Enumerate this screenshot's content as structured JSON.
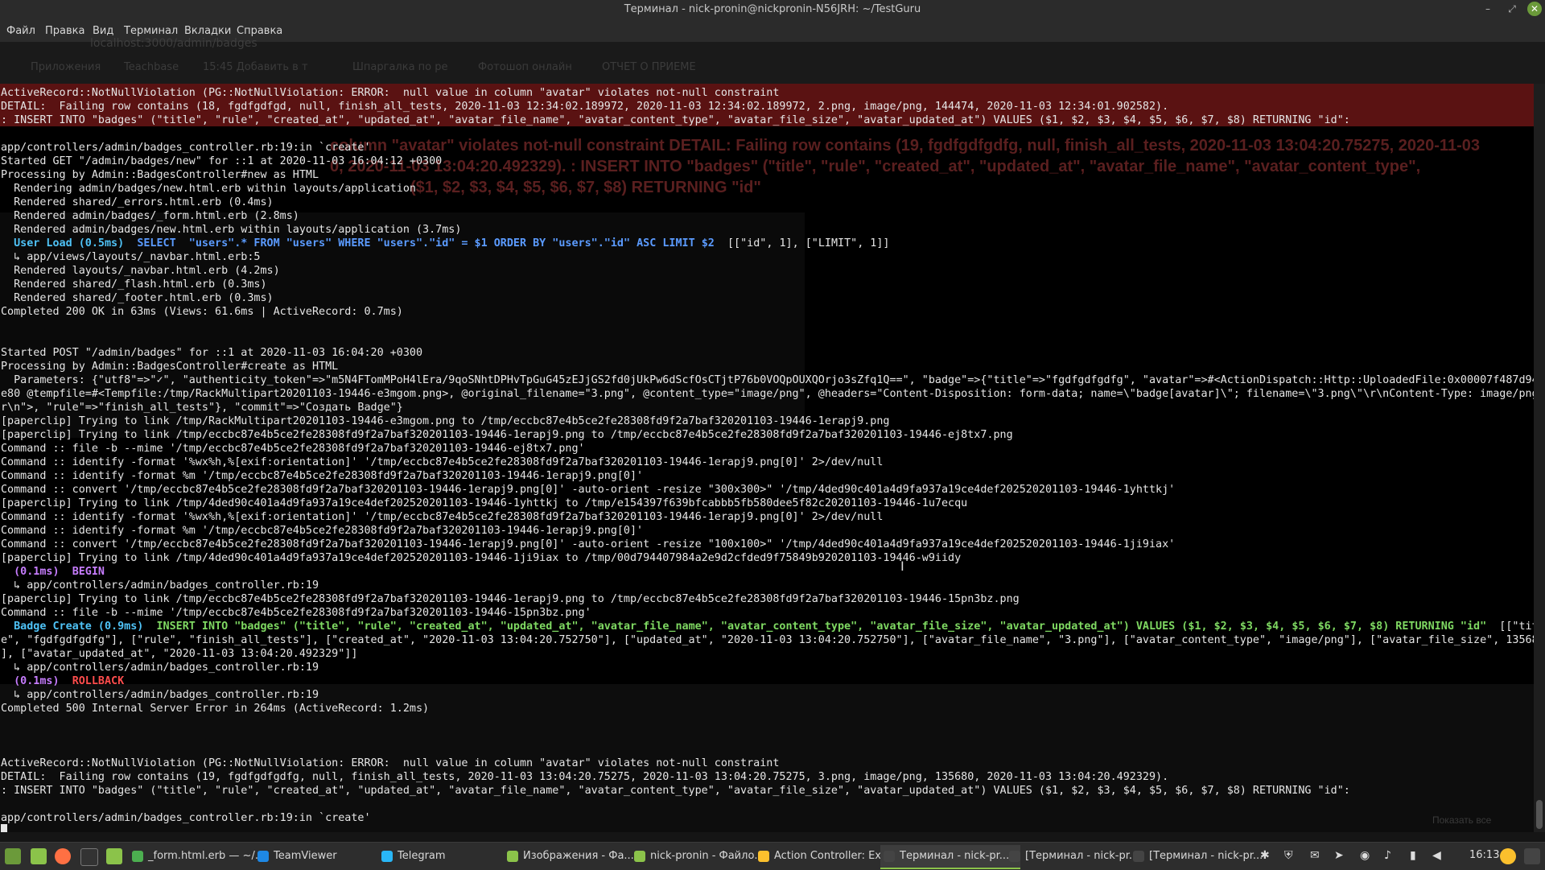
{
  "window": {
    "title": "Терминал - nick-pronin@nickpronin-N56JRH: ~/TestGuru",
    "controls": [
      "–",
      "⤢",
      "✕"
    ]
  },
  "menu": [
    "Файл",
    "Правка",
    "Вид",
    "Терминал",
    "Вкладки",
    "Справка"
  ],
  "ghost_browser": {
    "url": "localhost:3000/admin/badges",
    "bookmarks": [
      "Приложения",
      "Teachbase",
      "15:45 Добавить в т",
      "Шпаргалка по ре",
      "Фотошоп онлайн",
      "ОТЧЕТ О ПРИЕМЕ"
    ]
  },
  "ghost_error": [
    "column \"avatar\" violates not-null constraint DETAIL: Failing row contains (19, fgdfgdfgdfg, null, finish_all_tests, 2020-11-03 13:04:20.75275, 2020-11-03",
    "0, 2020-11-03 13:04:20.492329). : INSERT INTO \"badges\" (\"title\", \"rule\", \"created_at\", \"updated_at\", \"avatar_file_name\", \"avatar_content_type\",",
    "($1, $2, $3, $4, $5, $6, $7, $8) RETURNING \"id\""
  ],
  "terminal": {
    "lines": [
      {
        "row": 0,
        "text": "ActiveRecord::NotNullViolation (PG::NotNullViolation: ERROR:  null value in column \"avatar\" violates not-null constraint"
      },
      {
        "row": 1,
        "text": "DETAIL:  Failing row contains (18, fgdfgdfgd, null, finish_all_tests, 2020-11-03 12:34:02.189972, 2020-11-03 12:34:02.189972, 2.png, image/png, 144474, 2020-11-03 12:34:01.902582)."
      },
      {
        "row": 2,
        "text": ": INSERT INTO \"badges\" (\"title\", \"rule\", \"created_at\", \"updated_at\", \"avatar_file_name\", \"avatar_content_type\", \"avatar_file_size\", \"avatar_updated_at\") VALUES ($1, $2, $3, $4, $5, $6, $7, $8) RETURNING \"id\":"
      },
      {
        "row": 4,
        "text": "app/controllers/admin/badges_controller.rb:19:in `create'"
      },
      {
        "row": 5,
        "text": "Started GET \"/admin/badges/new\" for ::1 at 2020-11-03 16:04:12 +0300"
      },
      {
        "row": 6,
        "text": "Processing by Admin::BadgesController#new as HTML"
      },
      {
        "row": 7,
        "text": "  Rendering admin/badges/new.html.erb within layouts/application"
      },
      {
        "row": 8,
        "text": "  Rendered shared/_errors.html.erb (0.4ms)"
      },
      {
        "row": 9,
        "text": "  Rendered admin/badges/_form.html.erb (2.8ms)"
      },
      {
        "row": 10,
        "text": "  Rendered admin/badges/new.html.erb within layouts/application (3.7ms)"
      },
      {
        "row": 11,
        "segments": [
          {
            "text": "  "
          },
          {
            "text": "User Load (0.5ms)",
            "cls": "c-cyan"
          },
          {
            "text": "  "
          },
          {
            "text": "SELECT  \"users\".* FROM \"users\" WHERE \"users\".\"id\" = $1 ORDER BY \"users\".\"id\" ASC LIMIT $2",
            "cls": "c-blue"
          },
          {
            "text": "  [[\"id\", 1], [\"LIMIT\", 1]]"
          }
        ]
      },
      {
        "row": 12,
        "text": "  ↳ app/views/layouts/_navbar.html.erb:5"
      },
      {
        "row": 13,
        "text": "  Rendered layouts/_navbar.html.erb (4.2ms)"
      },
      {
        "row": 14,
        "text": "  Rendered shared/_flash.html.erb (0.3ms)"
      },
      {
        "row": 15,
        "text": "  Rendered shared/_footer.html.erb (0.3ms)"
      },
      {
        "row": 16,
        "text": "Completed 200 OK in 63ms (Views: 61.6ms | ActiveRecord: 0.7ms)"
      },
      {
        "row": 19,
        "text": "Started POST \"/admin/badges\" for ::1 at 2020-11-03 16:04:20 +0300"
      },
      {
        "row": 20,
        "text": "Processing by Admin::BadgesController#create as HTML"
      },
      {
        "row": 21,
        "text": "  Parameters: {\"utf8\"=>\"✓\", \"authenticity_token\"=>\"m5N4FTomMPoH4lEra/9qoSNhtDPHvTpGuG45zEJjGS2fd0jUkPw6dScfOsCTjtP76b0VOQpOUXQOrjo3sZfq1Q==\", \"badge\"=>{\"title\"=>\"fgdfgdfgdfg\", \"avatar\"=>#<ActionDispatch::Http::UploadedFile:0x00007f487d941"
      },
      {
        "row": 22,
        "text": "e80 @tempfile=#<Tempfile:/tmp/RackMultipart20201103-19446-e3mgom.png>, @original_filename=\"3.png\", @content_type=\"image/png\", @headers=\"Content-Disposition: form-data; name=\\\"badge[avatar]\\\"; filename=\\\"3.png\\\"\\r\\nContent-Type: image/png\\"
      },
      {
        "row": 23,
        "text": "r\\n\">, \"rule\"=>\"finish_all_tests\"}, \"commit\"=>\"Создать Badge\"}"
      },
      {
        "row": 24,
        "text": "[paperclip] Trying to link /tmp/RackMultipart20201103-19446-e3mgom.png to /tmp/eccbc87e4b5ce2fe28308fd9f2a7baf320201103-19446-1erapj9.png"
      },
      {
        "row": 25,
        "text": "[paperclip] Trying to link /tmp/eccbc87e4b5ce2fe28308fd9f2a7baf320201103-19446-1erapj9.png to /tmp/eccbc87e4b5ce2fe28308fd9f2a7baf320201103-19446-ej8tx7.png"
      },
      {
        "row": 26,
        "text": "Command :: file -b --mime '/tmp/eccbc87e4b5ce2fe28308fd9f2a7baf320201103-19446-ej8tx7.png'"
      },
      {
        "row": 27,
        "text": "Command :: identify -format '%wx%h,%[exif:orientation]' '/tmp/eccbc87e4b5ce2fe28308fd9f2a7baf320201103-19446-1erapj9.png[0]' 2>/dev/null"
      },
      {
        "row": 28,
        "text": "Command :: identify -format %m '/tmp/eccbc87e4b5ce2fe28308fd9f2a7baf320201103-19446-1erapj9.png[0]'"
      },
      {
        "row": 29,
        "text": "Command :: convert '/tmp/eccbc87e4b5ce2fe28308fd9f2a7baf320201103-19446-1erapj9.png[0]' -auto-orient -resize \"300x300>\" '/tmp/4ded90c401a4d9fa937a19ce4def202520201103-19446-1yhttkj'"
      },
      {
        "row": 30,
        "text": "[paperclip] Trying to link /tmp/4ded90c401a4d9fa937a19ce4def202520201103-19446-1yhttkj to /tmp/e154397f639bfcabbb5fb580dee5f82c20201103-19446-1u7ecqu"
      },
      {
        "row": 31,
        "text": "Command :: identify -format '%wx%h,%[exif:orientation]' '/tmp/eccbc87e4b5ce2fe28308fd9f2a7baf320201103-19446-1erapj9.png[0]' 2>/dev/null"
      },
      {
        "row": 32,
        "text": "Command :: identify -format %m '/tmp/eccbc87e4b5ce2fe28308fd9f2a7baf320201103-19446-1erapj9.png[0]'"
      },
      {
        "row": 33,
        "text": "Command :: convert '/tmp/eccbc87e4b5ce2fe28308fd9f2a7baf320201103-19446-1erapj9.png[0]' -auto-orient -resize \"100x100>\" '/tmp/4ded90c401a4d9fa937a19ce4def202520201103-19446-1ji9iax'"
      },
      {
        "row": 34,
        "text": "[paperclip] Trying to link /tmp/4ded90c401a4d9fa937a19ce4def202520201103-19446-1ji9iax to /tmp/00d794407984a2e9d2cfded9f75849b920201103-19446-w9iidy"
      },
      {
        "row": 35,
        "segments": [
          {
            "text": "  "
          },
          {
            "text": "(0.1ms)",
            "cls": "c-purple"
          },
          {
            "text": "  "
          },
          {
            "text": "BEGIN",
            "cls": "c-purple"
          }
        ]
      },
      {
        "row": 36,
        "text": "  ↳ app/controllers/admin/badges_controller.rb:19"
      },
      {
        "row": 37,
        "text": "[paperclip] Trying to link /tmp/eccbc87e4b5ce2fe28308fd9f2a7baf320201103-19446-1erapj9.png to /tmp/eccbc87e4b5ce2fe28308fd9f2a7baf320201103-19446-15pn3bz.png"
      },
      {
        "row": 38,
        "text": "Command :: file -b --mime '/tmp/eccbc87e4b5ce2fe28308fd9f2a7baf320201103-19446-15pn3bz.png'"
      },
      {
        "row": 39,
        "segments": [
          {
            "text": "  "
          },
          {
            "text": "Badge Create (0.9ms)",
            "cls": "c-cyan"
          },
          {
            "text": "  "
          },
          {
            "text": "INSERT INTO \"badges\" (\"title\", \"rule\", \"created_at\", \"updated_at\", \"avatar_file_name\", \"avatar_content_type\", \"avatar_file_size\", \"avatar_updated_at\") VALUES ($1, $2, $3, $4, $5, $6, $7, $8) RETURNING \"id\"",
            "cls": "c-green"
          },
          {
            "text": "  [[\"titl"
          }
        ]
      },
      {
        "row": 40,
        "text": "e\", \"fgdfgdfgdfg\"], [\"rule\", \"finish_all_tests\"], [\"created_at\", \"2020-11-03 13:04:20.752750\"], [\"updated_at\", \"2020-11-03 13:04:20.752750\"], [\"avatar_file_name\", \"3.png\"], [\"avatar_content_type\", \"image/png\"], [\"avatar_file_size\", 135680"
      },
      {
        "row": 41,
        "text": "], [\"avatar_updated_at\", \"2020-11-03 13:04:20.492329\"]]"
      },
      {
        "row": 42,
        "text": "  ↳ app/controllers/admin/badges_controller.rb:19"
      },
      {
        "row": 43,
        "segments": [
          {
            "text": "  "
          },
          {
            "text": "(0.1ms)",
            "cls": "c-purple"
          },
          {
            "text": "  "
          },
          {
            "text": "ROLLBACK",
            "cls": "c-red"
          }
        ]
      },
      {
        "row": 44,
        "text": "  ↳ app/controllers/admin/badges_controller.rb:19"
      },
      {
        "row": 45,
        "text": "Completed 500 Internal Server Error in 264ms (ActiveRecord: 1.2ms)"
      },
      {
        "row": 49,
        "text": "ActiveRecord::NotNullViolation (PG::NotNullViolation: ERROR:  null value in column \"avatar\" violates not-null constraint"
      },
      {
        "row": 50,
        "text": "DETAIL:  Failing row contains (19, fgdfgdfgdfg, null, finish_all_tests, 2020-11-03 13:04:20.75275, 2020-11-03 13:04:20.75275, 3.png, image/png, 135680, 2020-11-03 13:04:20.492329)."
      },
      {
        "row": 51,
        "text": ": INSERT INTO \"badges\" (\"title\", \"rule\", \"created_at\", \"updated_at\", \"avatar_file_name\", \"avatar_content_type\", \"avatar_file_size\", \"avatar_updated_at\") VALUES ($1, $2, $3, $4, $5, $6, $7, $8) RETURNING \"id\":"
      },
      {
        "row": 53,
        "text": "app/controllers/admin/badges_controller.rb:19:in `create'"
      }
    ]
  },
  "ghost_button": "Показать все",
  "taskbar": {
    "tasks": [
      {
        "label": "_form.html.erb — ~/...",
        "icon_color": "#4caf50"
      },
      {
        "label": "TeamViewer",
        "icon_color": "#1e88e5"
      },
      {
        "label": "Telegram",
        "icon_color": "#29b6f6"
      },
      {
        "label": "Изображения - Фа...",
        "icon_color": "#8bc34a"
      },
      {
        "label": "nick-pronin - Файло...",
        "icon_color": "#8bc34a"
      },
      {
        "label": "Action Controller: Ex...",
        "icon_color": "#fbc02d"
      },
      {
        "label": "Терминал - nick-pr...",
        "icon_color": "#444444",
        "active": true
      },
      {
        "label": "[Терминал - nick-pr...",
        "icon_color": "#444444"
      },
      {
        "label": "[Терминал - nick-pr...",
        "icon_color": "#444444"
      }
    ],
    "clock": "16:13"
  }
}
